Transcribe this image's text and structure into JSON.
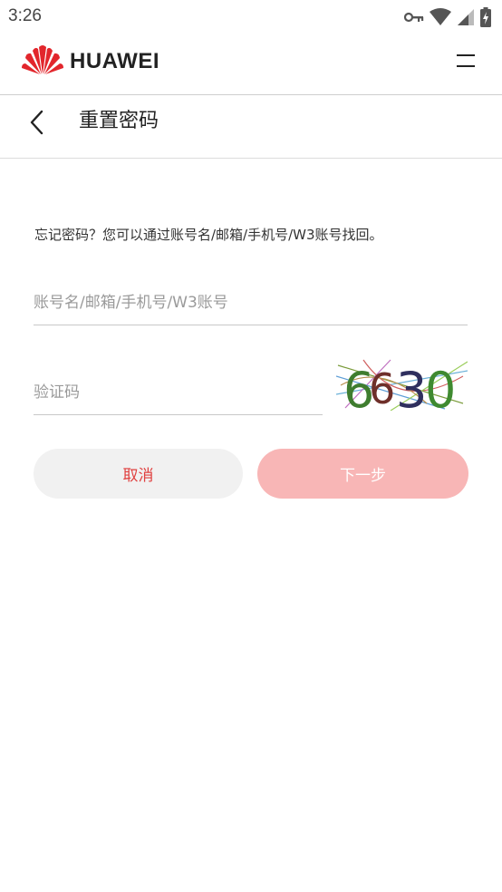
{
  "status_bar": {
    "time": "3:26"
  },
  "header": {
    "brand": "HUAWEI"
  },
  "page": {
    "title": "重置密码"
  },
  "form": {
    "hint": "忘记密码？您可以通过账号名/邮箱/手机号/W3账号找回。",
    "account_placeholder": "账号名/邮箱/手机号/W3账号",
    "captcha_placeholder": "验证码",
    "captcha_text": "6630",
    "cancel_label": "取消",
    "next_label": "下一步"
  },
  "colors": {
    "brand_red": "#e2262c",
    "cancel_text": "#e0403f",
    "next_bg": "#f8b6b6",
    "cancel_bg": "#f1f1f1"
  }
}
